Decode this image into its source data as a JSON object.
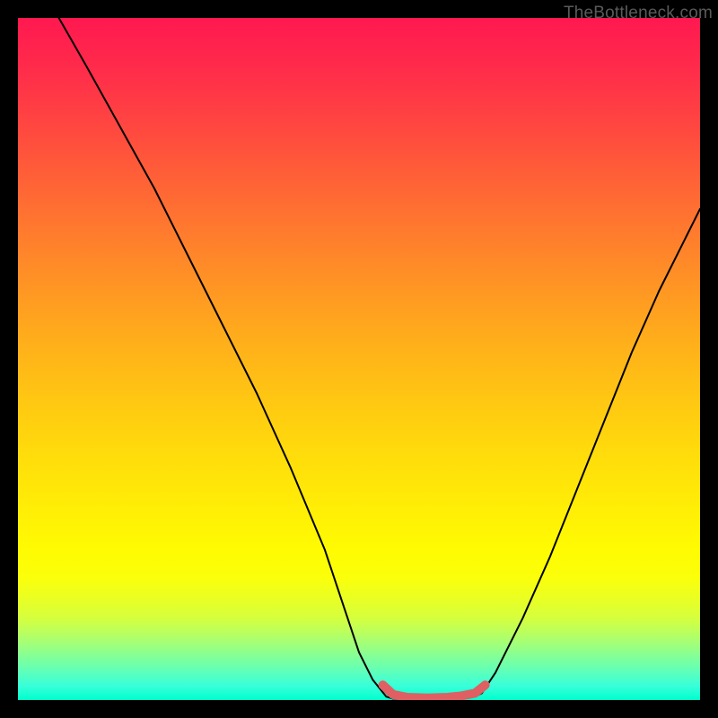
{
  "watermark": "TheBottleneck.com",
  "chart_data": {
    "type": "line",
    "title": "",
    "xlabel": "",
    "ylabel": "",
    "xlim": [
      0,
      100
    ],
    "ylim": [
      0,
      100
    ],
    "series": [
      {
        "name": "left-curve",
        "x": [
          6,
          10,
          15,
          20,
          25,
          30,
          35,
          40,
          45,
          48,
          50,
          52,
          54
        ],
        "y": [
          100,
          93,
          84,
          75,
          65,
          55,
          45,
          34,
          22,
          13,
          7,
          3,
          0.5
        ]
      },
      {
        "name": "bottom-segment",
        "x": [
          54,
          55,
          56,
          58,
          60,
          62,
          64,
          66,
          67,
          68
        ],
        "y": [
          0.5,
          0.2,
          0.1,
          0.1,
          0.1,
          0.1,
          0.2,
          0.3,
          0.5,
          1
        ]
      },
      {
        "name": "right-curve",
        "x": [
          68,
          70,
          74,
          78,
          82,
          86,
          90,
          94,
          98,
          100
        ],
        "y": [
          1,
          4,
          12,
          21,
          31,
          41,
          51,
          60,
          68,
          72
        ]
      }
    ],
    "highlight": {
      "name": "bottom-highlight",
      "color": "#e06060",
      "x": [
        53.5,
        55,
        57,
        60,
        63,
        65,
        67,
        68.5
      ],
      "y": [
        2.2,
        0.8,
        0.4,
        0.3,
        0.4,
        0.6,
        1.0,
        2.2
      ]
    }
  }
}
